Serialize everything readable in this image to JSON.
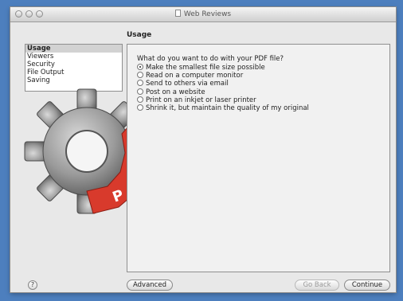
{
  "window": {
    "title": "Web Reviews"
  },
  "section_title": "Usage",
  "sidebar": {
    "items": [
      {
        "label": "Usage",
        "selected": true
      },
      {
        "label": "Viewers",
        "selected": false
      },
      {
        "label": "Security",
        "selected": false
      },
      {
        "label": "File Output",
        "selected": false
      },
      {
        "label": "Saving",
        "selected": false
      }
    ]
  },
  "logo_text": "PDF",
  "main": {
    "question": "What do you want to do with your PDF file?",
    "options": [
      {
        "label": "Make the smallest file size possible",
        "checked": true
      },
      {
        "label": "Read on a computer monitor",
        "checked": false
      },
      {
        "label": "Send to others via email",
        "checked": false
      },
      {
        "label": "Post on a website",
        "checked": false
      },
      {
        "label": "Print on an inkjet or laser printer",
        "checked": false
      },
      {
        "label": "Shrink it, but maintain the quality of my original",
        "checked": false
      }
    ]
  },
  "footer": {
    "help_label": "?",
    "advanced_label": "Advanced",
    "go_back_label": "Go Back",
    "continue_label": "Continue"
  },
  "colors": {
    "desktop": "#4d7fbe",
    "logo_red": "#d83a2c",
    "gear_grey": "#8a8a8a"
  }
}
